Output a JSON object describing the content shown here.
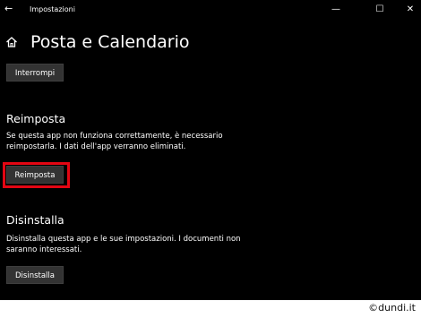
{
  "window": {
    "title": "Impostazioni",
    "back_glyph": "←",
    "minimize_glyph": "—",
    "maximize_glyph": "☐",
    "close_glyph": "✕"
  },
  "header": {
    "home_icon": "home-icon",
    "app_name": "Posta e Calendario"
  },
  "terminate": {
    "button_label": "Interrompi"
  },
  "reset": {
    "heading": "Reimposta",
    "description_line1": "Se questa app non funziona correttamente, è necessario",
    "description_line2": "reimpostarla. I dati dell'app verranno eliminati.",
    "button_label": "Reimposta",
    "highlight_color": "#e30613"
  },
  "uninstall": {
    "heading": "Disinstalla",
    "description_line1": "Disinstalla questa app e le sue impostazioni. I documenti non",
    "description_line2": "saranno interessati.",
    "button_label": "Disinstalla"
  },
  "credit": "©dundi.it"
}
